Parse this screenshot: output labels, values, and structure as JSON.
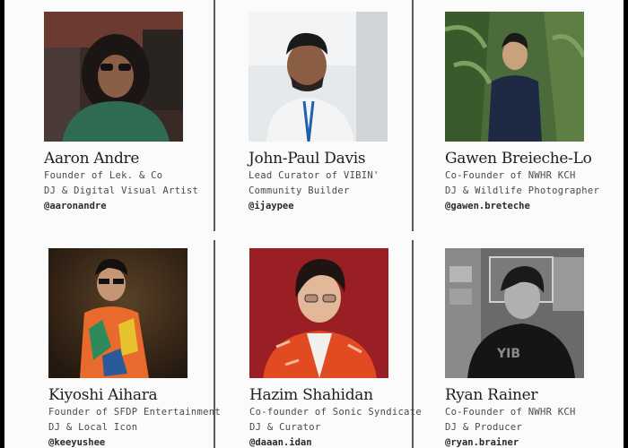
{
  "members": [
    {
      "name": "Aaron Andre",
      "line1": "Founder of Lek. & Co",
      "line2": "DJ & Digital Visual Artist",
      "handle": "@aaronandre"
    },
    {
      "name": "John-Paul Davis",
      "line1": "Lead Curator of VIBIN'",
      "line2": "Community Builder",
      "handle": "@ijaypee"
    },
    {
      "name": "Gawen Breieche-Lo",
      "line1": "Co-Founder of NWHR KCH",
      "line2": "DJ & Wildlife Photographer",
      "handle": "@gawen.breteche"
    },
    {
      "name": "Kiyoshi Aihara",
      "line1": "Founder of SFDP Entertainment",
      "line2": "DJ & Local Icon",
      "handle": "@keeyushee"
    },
    {
      "name": "Hazim Shahidan",
      "line1": "Co-founder of Sonic Syndicate",
      "line2": "DJ & Curator",
      "handle": "@daaan.idan"
    },
    {
      "name": "Ryan Rainer",
      "line1": "Co-Founder of NWHR KCH",
      "line2": "DJ & Producer",
      "handle": "@ryan.brainer"
    }
  ]
}
